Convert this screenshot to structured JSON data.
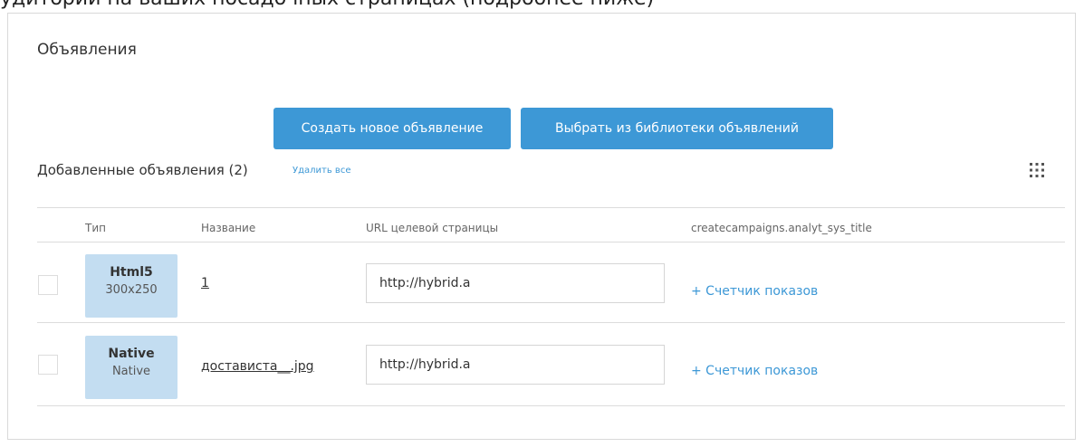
{
  "topbar_fragment": "удиторий на ваших посадочных страницах (подробнее ниже)",
  "panel": {
    "title": "Объявления",
    "create_button": "Создать новое объявление",
    "library_button": "Выбрать из библиотеки объявлений"
  },
  "added": {
    "title": "Добавленные объявления (2)",
    "delete_all": "Удалить все",
    "columns_icon": "grid-icon"
  },
  "table": {
    "headers": {
      "type": "Тип",
      "name": "Название",
      "url": "URL целевой страницы",
      "analytics": "createcampaigns.analyt_sys_title"
    },
    "rows": [
      {
        "type": "Html5",
        "size": "300x250",
        "name": "1",
        "url": "http://hybrid.a",
        "counter": "+ Счетчик показов"
      },
      {
        "type": "Native",
        "size": "Native",
        "name": "достависта__.jpg",
        "url": "http://hybrid.a",
        "counter": "+ Счетчик показов"
      }
    ]
  },
  "colors": {
    "accent": "#3d98d6",
    "badge": "#c3ddf1"
  }
}
